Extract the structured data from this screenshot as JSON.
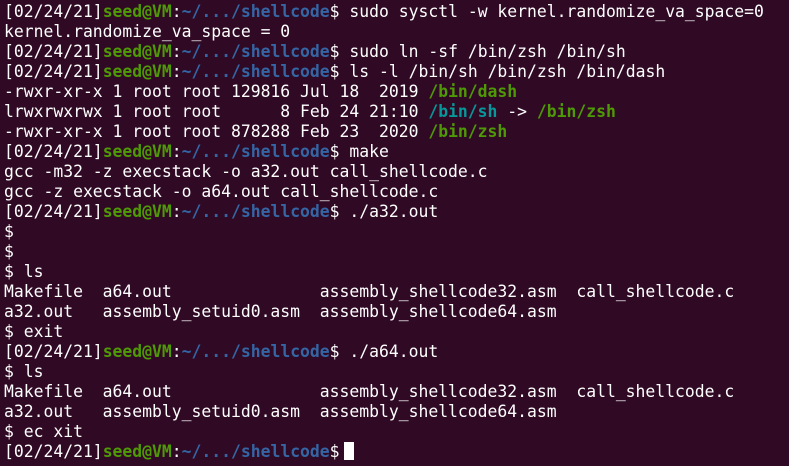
{
  "colors": {
    "background": "#300a24",
    "text": "#ffffff",
    "user_host": "#4e9a06",
    "path": "#3465a4",
    "symlink": "#06989a",
    "executable": "#4e9a06"
  },
  "prompt": {
    "date": "[02/24/21]",
    "user_host": "seed@VM",
    "colon": ":",
    "path": "~/.../shellcode",
    "symbol": "$"
  },
  "lines": [
    {
      "kind": "prompt",
      "cmd": " sudo sysctl -w kernel.randomize_va_space=0"
    },
    {
      "kind": "output",
      "text": "kernel.randomize_va_space = 0"
    },
    {
      "kind": "prompt",
      "cmd": " sudo ln -sf /bin/zsh /bin/sh"
    },
    {
      "kind": "prompt",
      "cmd": " ls -l /bin/sh /bin/zsh /bin/dash"
    },
    {
      "kind": "ls",
      "info": "-rwxr-xr-x 1 root root 129816 Jul 18  2019 ",
      "name": "/bin/dash"
    },
    {
      "kind": "lsl",
      "info": "lrwxrwxrwx 1 root root      8 Feb 24 21:10 ",
      "name": "/bin/sh",
      "arrow": " -> ",
      "target": "/bin/zsh"
    },
    {
      "kind": "ls",
      "info": "-rwxr-xr-x 1 root root 878288 Feb 23  2020 ",
      "name": "/bin/zsh"
    },
    {
      "kind": "prompt",
      "cmd": " make"
    },
    {
      "kind": "output",
      "text": "gcc -m32 -z execstack -o a32.out call_shellcode.c"
    },
    {
      "kind": "output",
      "text": "gcc -z execstack -o a64.out call_shellcode.c"
    },
    {
      "kind": "prompt",
      "cmd": " ./a32.out"
    },
    {
      "kind": "output",
      "text": "$"
    },
    {
      "kind": "output",
      "text": "$"
    },
    {
      "kind": "output",
      "text": "$ ls"
    },
    {
      "kind": "output",
      "text": "Makefile  a64.out               assembly_shellcode32.asm  call_shellcode.c"
    },
    {
      "kind": "output",
      "text": "a32.out   assembly_setuid0.asm  assembly_shellcode64.asm"
    },
    {
      "kind": "output",
      "text": "$ exit"
    },
    {
      "kind": "prompt",
      "cmd": " ./a64.out"
    },
    {
      "kind": "output",
      "text": "$ ls"
    },
    {
      "kind": "output",
      "text": "Makefile  a64.out               assembly_shellcode32.asm  call_shellcode.c"
    },
    {
      "kind": "output",
      "text": "a32.out   assembly_setuid0.asm  assembly_shellcode64.asm"
    },
    {
      "kind": "output",
      "text": "$ ec xit"
    },
    {
      "kind": "prompt",
      "cmd": " ",
      "cursor": true
    }
  ]
}
